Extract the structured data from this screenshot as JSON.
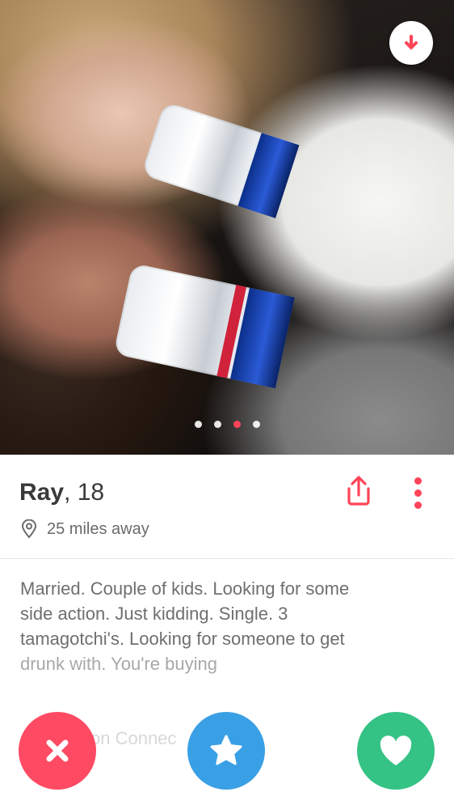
{
  "profile": {
    "name": "Ray",
    "age_text": ", 18",
    "distance": "25 miles away",
    "bio_lines": [
      "Married. Couple of kids. Looking for some",
      "side action. Just kidding. Single. 3",
      "tamagotchi's. Looking for someone to get",
      "drunk with. You're buying"
    ],
    "partial_section_label": "on Connec"
  },
  "photo_pager": {
    "count": 4,
    "active_index": 3
  },
  "icons": {
    "rewind": "arrow-down-icon",
    "location": "location-pin-icon",
    "share": "share-icon",
    "more": "more-vertical-icon",
    "nope": "x-icon",
    "superlike": "star-icon",
    "like": "heart-icon"
  },
  "colors": {
    "accent": "#ff4458",
    "nope": "#ff4a63",
    "superlike": "#3aa0e6",
    "like": "#35c285"
  }
}
